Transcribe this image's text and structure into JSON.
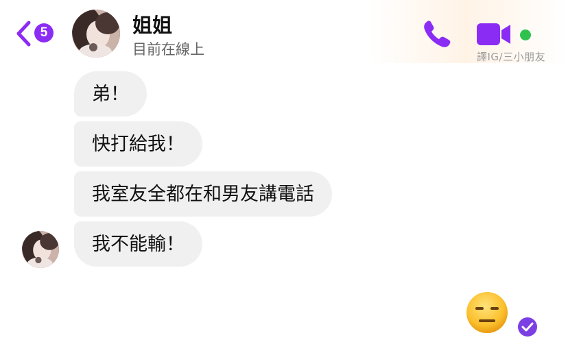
{
  "header": {
    "unread_count": "5",
    "contact_name": "姐姐",
    "status": "目前在線上",
    "watermark": "譯IG/三小朋友",
    "icons": [
      "back-chevron-icon",
      "phone-icon",
      "video-camera-icon"
    ],
    "accent_color": "#8b2cf5",
    "online_color": "#31c24d"
  },
  "messages": [
    {
      "sender": "contact",
      "text": "弟！"
    },
    {
      "sender": "contact",
      "text": "快打給我！"
    },
    {
      "sender": "contact",
      "text": "我室友全都在和男友講電話"
    },
    {
      "sender": "contact",
      "text": "我不能輸！"
    }
  ],
  "reply": {
    "emoji": "expressionless-face-emoji",
    "seen_icon": "seen-check-icon"
  }
}
